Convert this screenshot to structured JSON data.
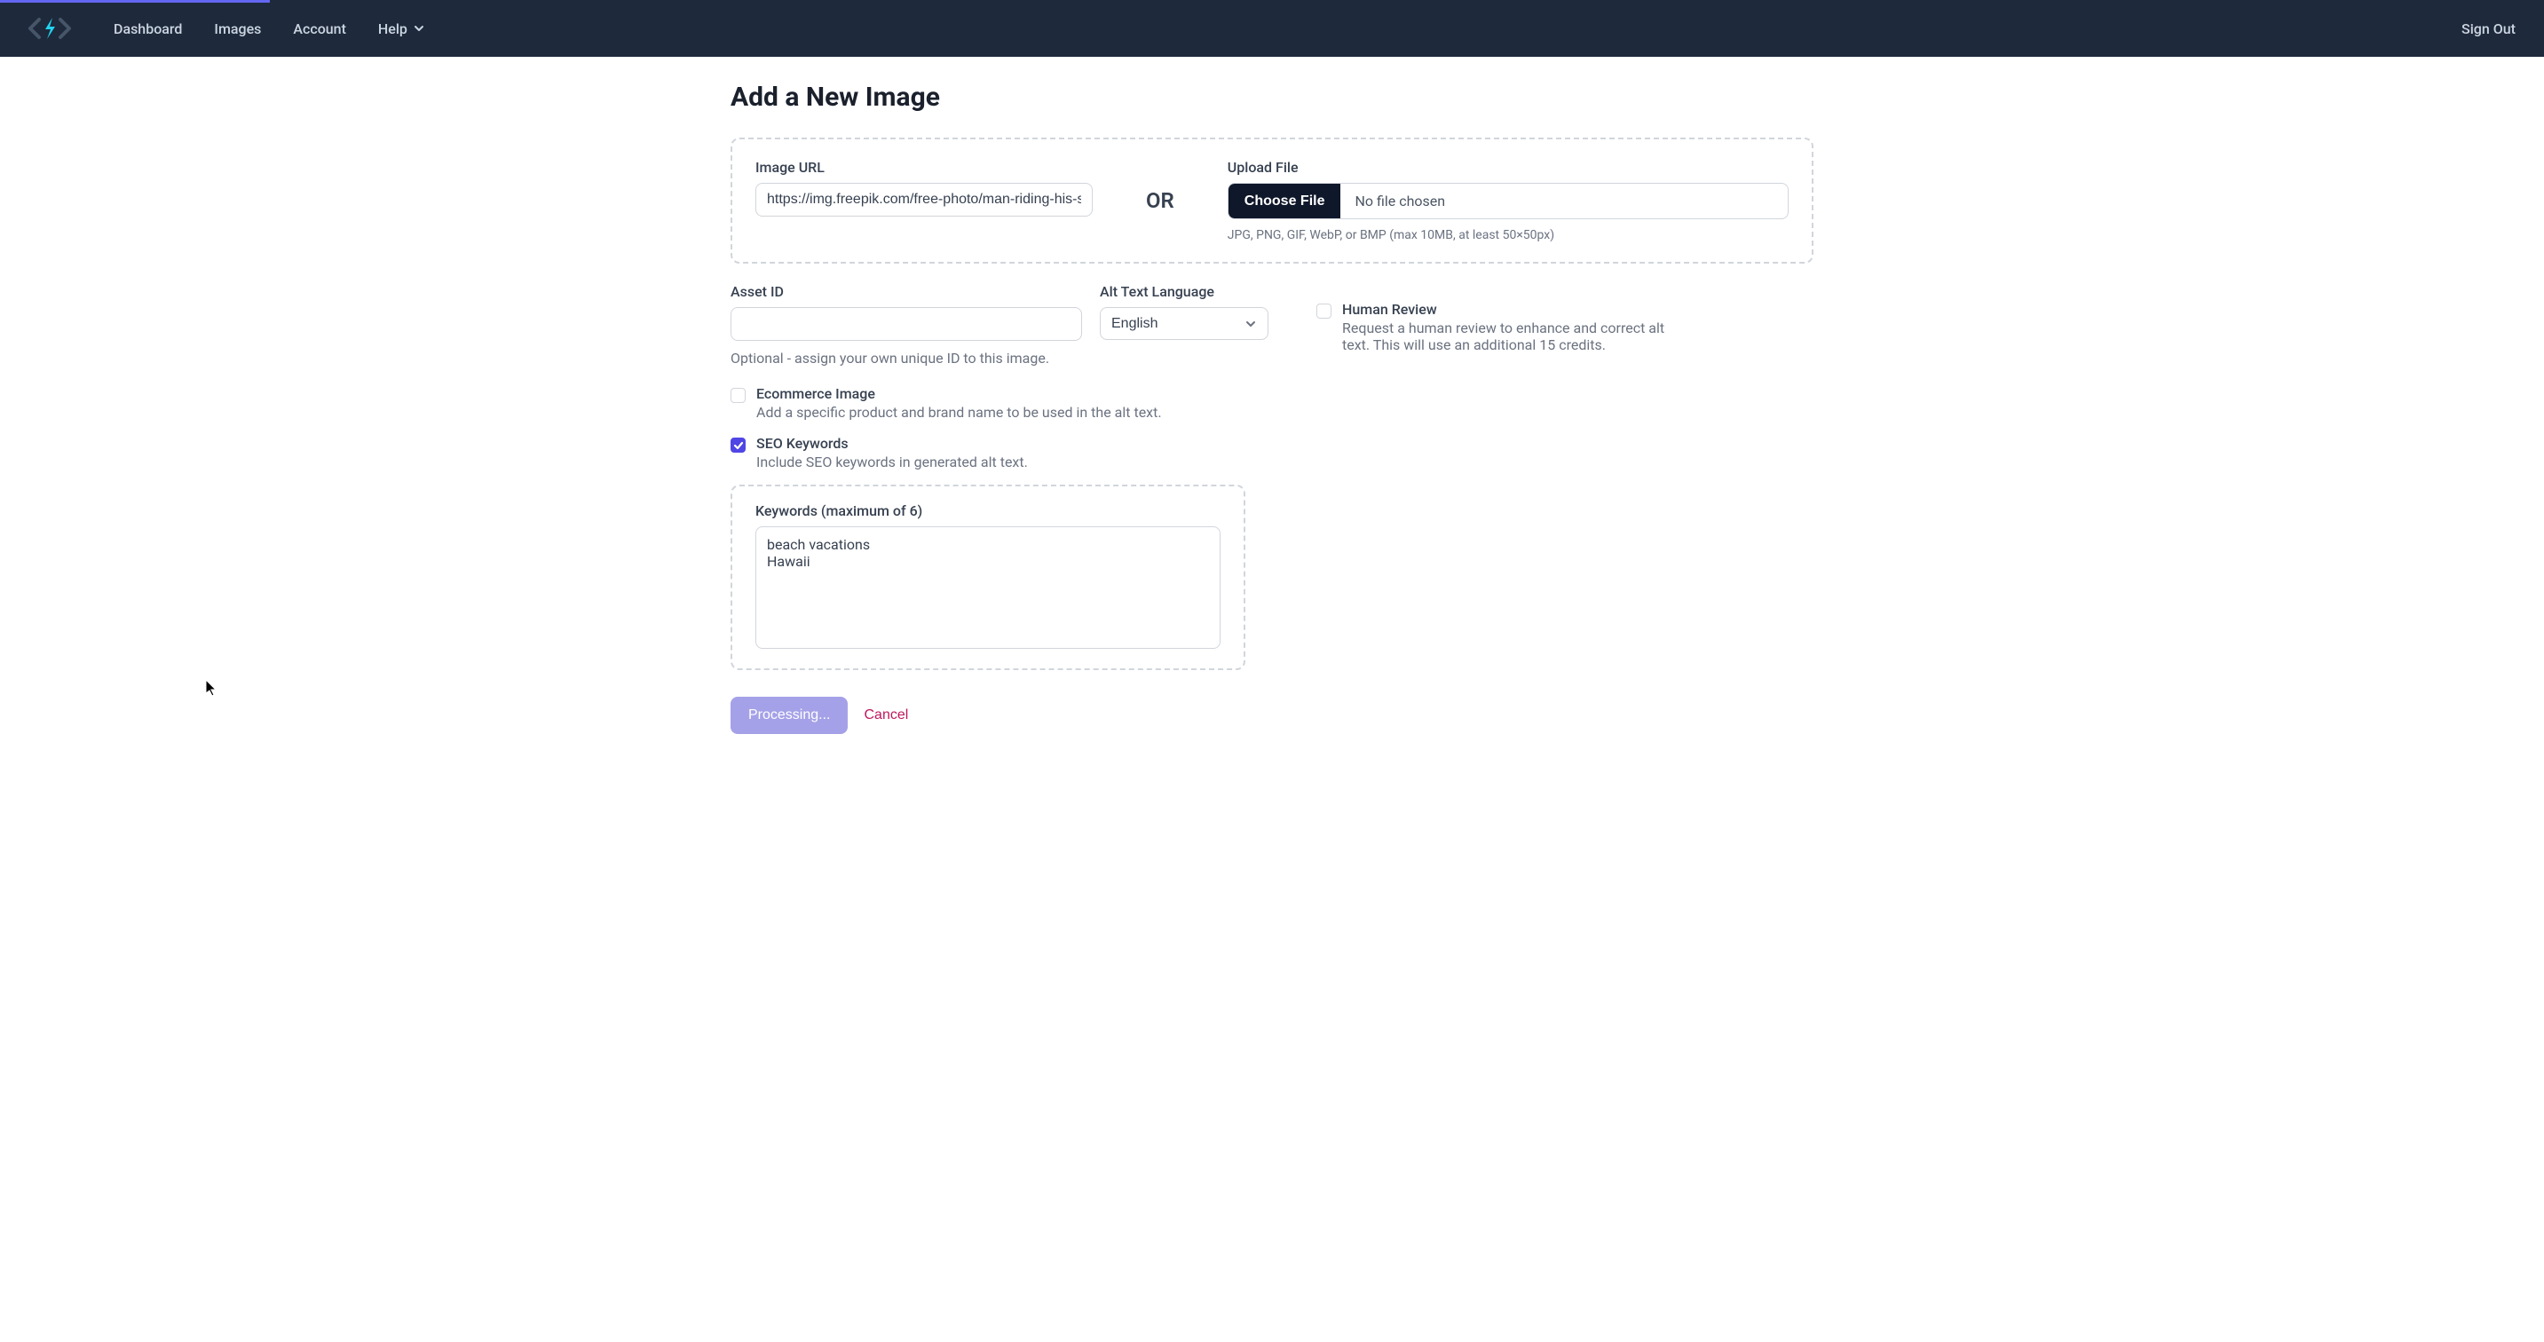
{
  "nav": {
    "items": [
      "Dashboard",
      "Images",
      "Account",
      "Help"
    ],
    "signout": "Sign Out"
  },
  "page": {
    "title": "Add a New Image"
  },
  "upload": {
    "url_label": "Image URL",
    "url_value": "https://img.freepik.com/free-photo/man-riding-his-su",
    "or_text": "OR",
    "file_label": "Upload File",
    "choose_button": "Choose File",
    "no_file_text": "No file chosen",
    "file_hint": "JPG, PNG, GIF, WebP, or BMP (max 10MB, at least 50×50px)"
  },
  "asset_id": {
    "label": "Asset ID",
    "value": "",
    "help": "Optional - assign your own unique ID to this image."
  },
  "language": {
    "label": "Alt Text Language",
    "selected": "English"
  },
  "human_review": {
    "label": "Human Review",
    "desc": "Request a human review to enhance and correct alt text. This will use an additional 15 credits.",
    "checked": false
  },
  "ecommerce": {
    "label": "Ecommerce Image",
    "desc": "Add a specific product and brand name to be used in the alt text.",
    "checked": false
  },
  "seo": {
    "label": "SEO Keywords",
    "desc": "Include SEO keywords in generated alt text.",
    "checked": true
  },
  "keywords": {
    "label": "Keywords (maximum of 6)",
    "value": "beach vacations\nHawaii"
  },
  "buttons": {
    "submit": "Processing...",
    "cancel": "Cancel"
  }
}
